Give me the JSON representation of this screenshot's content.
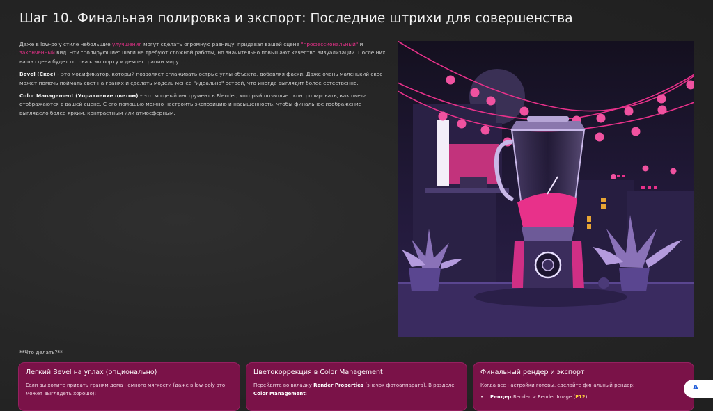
{
  "page": {
    "title": "Шаг 10. Финальная полировка и экспорт: Последние штрихи для совершенства"
  },
  "intro": {
    "p1_a": "Даже в low-poly стиле небольшие ",
    "p1_hl1": "улучшения",
    "p1_b": " могут сделать огромную разницу, придавая вашей сцене ",
    "p1_hl2": "\"профессиональный\"",
    "p1_c": " и ",
    "p1_hl3": "законченный",
    "p1_d": " вид. Эти \"полирующие\" шаги не требуют сложной работы, но значительно повышают качество визуализации. После них ваша сцена будет готова к экспорту и демонстрации миру.",
    "p2_bold": "Bevel (Скос)",
    "p2_rest": " – это модификатор, который позволяет сглаживать острые углы объекта, добавляя фаски. Даже очень маленький скос может помочь поймать свет на гранях и сделать модель менее \"идеально\" острой, что иногда выглядит более естественно.",
    "p3_bold": "Color Management (Управление цветом)",
    "p3_rest": " – это мощный инструмент в Blender, который позволяет контролировать, как цвета отображаются в вашей сцене. С его помощью можно настроить экспозицию и насыщенность, чтобы финальное изображение выглядело более ярким, контрастным или атмосферным."
  },
  "what_to_do": "**Что делать?**",
  "cards": [
    {
      "title": "Легкий Bevel на углах (опционально)",
      "body": "Если вы хотите придать граням дома немного мягкости (даже в low-poly это может выглядеть хорошо):"
    },
    {
      "title": "Цветокоррекция в Color Management",
      "body_a": "Перейдите во вкладку ",
      "body_bold1": "Render Properties",
      "body_b": " (значок фотоаппарата). В разделе ",
      "body_bold2": "Color Management",
      "body_c": ":"
    },
    {
      "title": "Финальный рендер и экспорт",
      "body": "Когда все настройки готовы, сделайте финальный рендер:",
      "bullet_dot": "•",
      "bullet_bold": "Рендер:",
      "bullet_text": "Render > Render Image (",
      "bullet_key": "F12",
      "bullet_end": ")."
    }
  ],
  "corner_button_label": "A",
  "illustration": {
    "colors": {
      "bg": "#1b1430",
      "accent": "#e8318a",
      "purple": "#5a3d86",
      "floor": "#3d2d63"
    }
  }
}
